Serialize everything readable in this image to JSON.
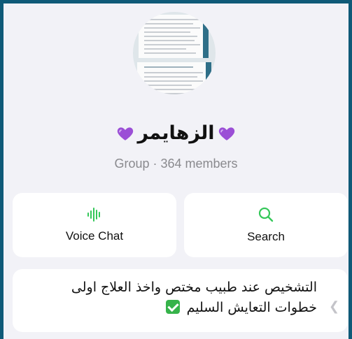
{
  "group": {
    "name": "الزهايمر",
    "subtitle": "Group · 364 members"
  },
  "actions": {
    "voice_chat_label": "Voice Chat",
    "search_label": "Search"
  },
  "description": {
    "text": "التشخيص عند طبيب مختص واخذ العلاج اولى خطوات التعايش السليم",
    "emoji": "white-check-mark"
  },
  "colors": {
    "accent": "#34c759",
    "heart": "#9b4fd6",
    "background": "#0f5a78"
  }
}
